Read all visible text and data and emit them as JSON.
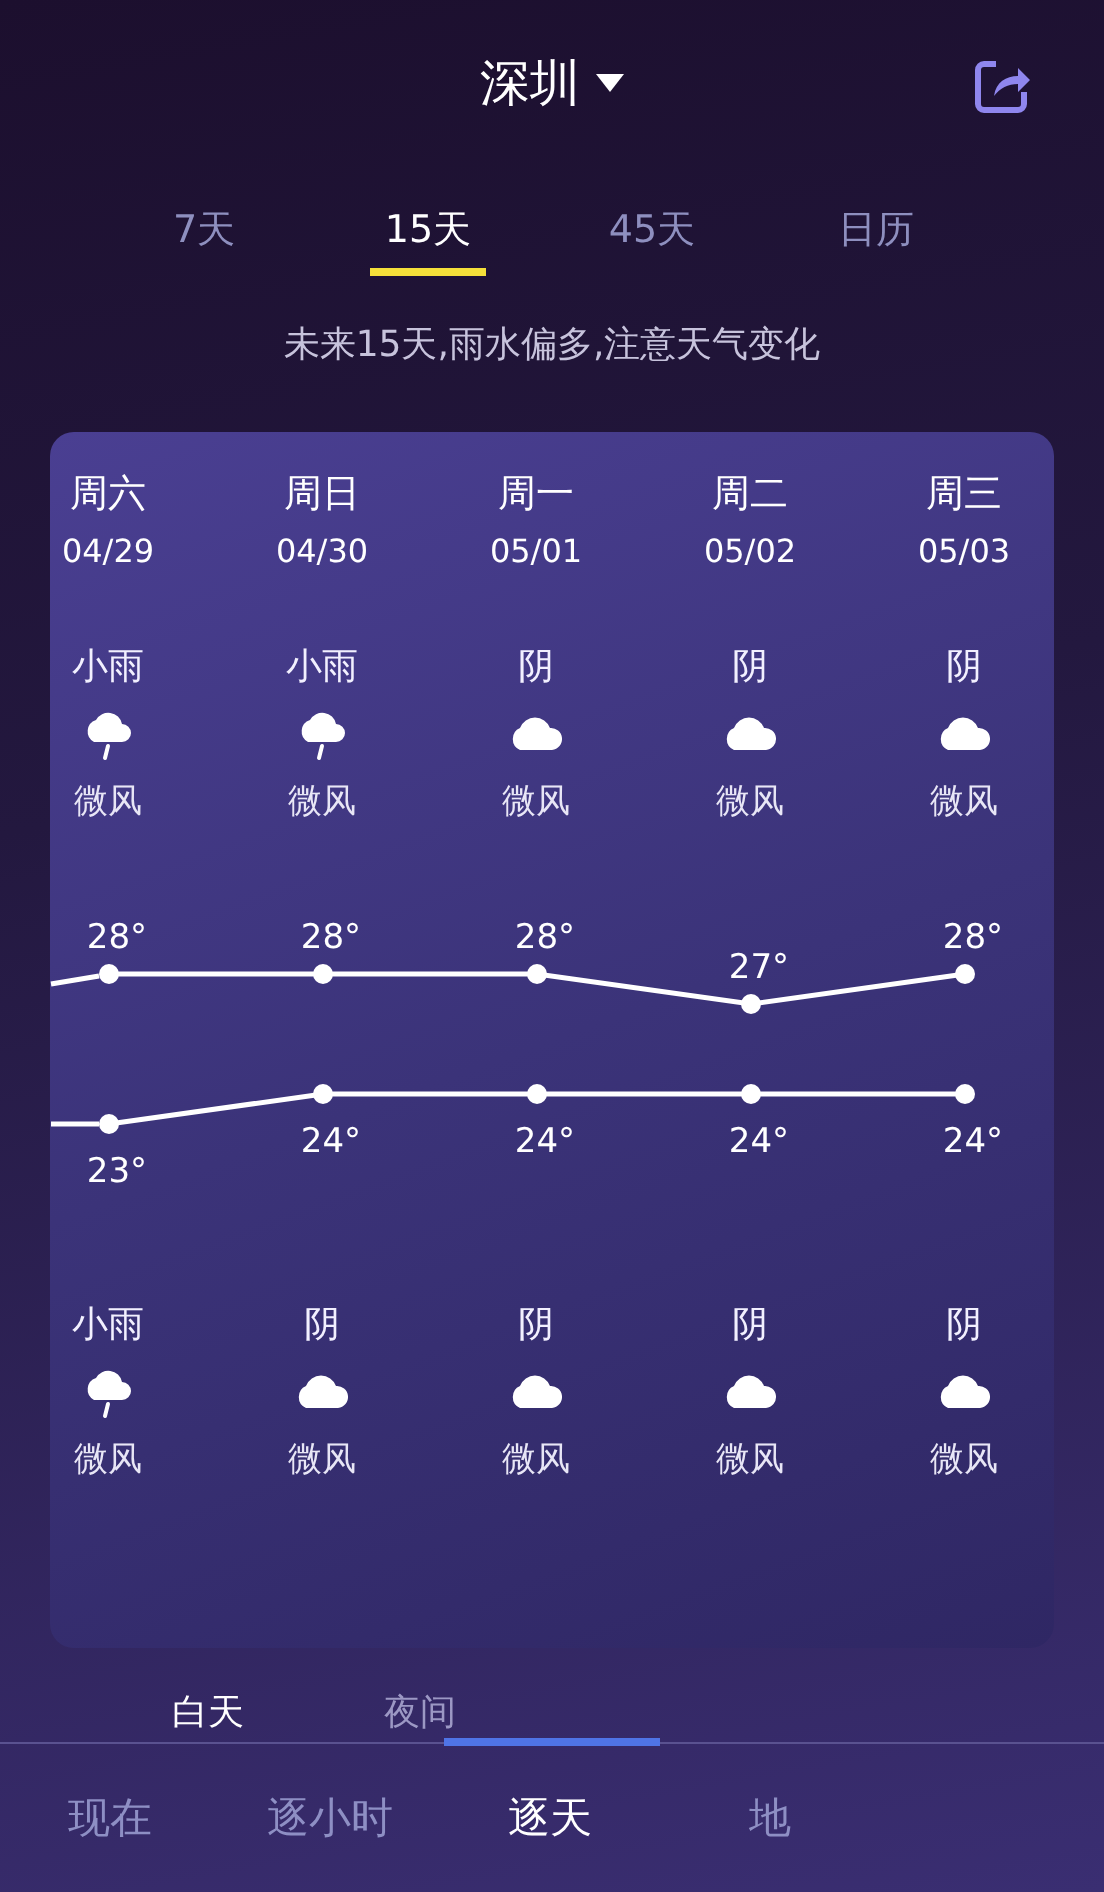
{
  "header": {
    "city": "深圳"
  },
  "tabs": [
    {
      "label": "7天",
      "selected": false
    },
    {
      "label": "15天",
      "selected": true
    },
    {
      "label": "45天",
      "selected": false
    },
    {
      "label": "日历",
      "selected": false
    }
  ],
  "notice": "未来15天,雨水偏多,注意天气变化",
  "days": [
    {
      "weekday": "周六",
      "date": "04/29",
      "day": {
        "kind": "rain",
        "condition": "小雨",
        "wind": "微风"
      },
      "night": {
        "kind": "rain",
        "condition": "小雨",
        "wind": "微风"
      }
    },
    {
      "weekday": "周日",
      "date": "04/30",
      "day": {
        "kind": "rain",
        "condition": "小雨",
        "wind": "微风"
      },
      "night": {
        "kind": "cloud",
        "condition": "阴",
        "wind": "微风"
      }
    },
    {
      "weekday": "周一",
      "date": "05/01",
      "day": {
        "kind": "cloud",
        "condition": "阴",
        "wind": "微风"
      },
      "night": {
        "kind": "cloud",
        "condition": "阴",
        "wind": "微风"
      }
    },
    {
      "weekday": "周二",
      "date": "05/02",
      "day": {
        "kind": "cloud",
        "condition": "阴",
        "wind": "微风"
      },
      "night": {
        "kind": "cloud",
        "condition": "阴",
        "wind": "微风"
      }
    },
    {
      "weekday": "周三",
      "date": "05/03",
      "day": {
        "kind": "cloud",
        "condition": "阴",
        "wind": "微风"
      },
      "night": {
        "kind": "cloud",
        "condition": "阴",
        "wind": "微风"
      }
    }
  ],
  "chart_data": {
    "type": "line",
    "series": [
      {
        "color": "#ffffff",
        "marker": "circle",
        "values": [
          28,
          28,
          28,
          27,
          28
        ],
        "value_labels": [
          "28°",
          "28°",
          "28°",
          "27°",
          "28°"
        ]
      },
      {
        "color": "#ffffff",
        "marker": "circle",
        "values": [
          23,
          24,
          24,
          24,
          24
        ],
        "value_labels": [
          "23°",
          "24°",
          "24°",
          "24°",
          "24°"
        ]
      }
    ]
  },
  "period_tabs": [
    {
      "label": "白天",
      "selected": true
    },
    {
      "label": "夜间",
      "selected": false
    }
  ],
  "nav": [
    {
      "label": "现在",
      "selected": false
    },
    {
      "label": "逐小时",
      "selected": false
    },
    {
      "label": "逐天",
      "selected": true
    },
    {
      "label": "地",
      "selected": false
    }
  ]
}
